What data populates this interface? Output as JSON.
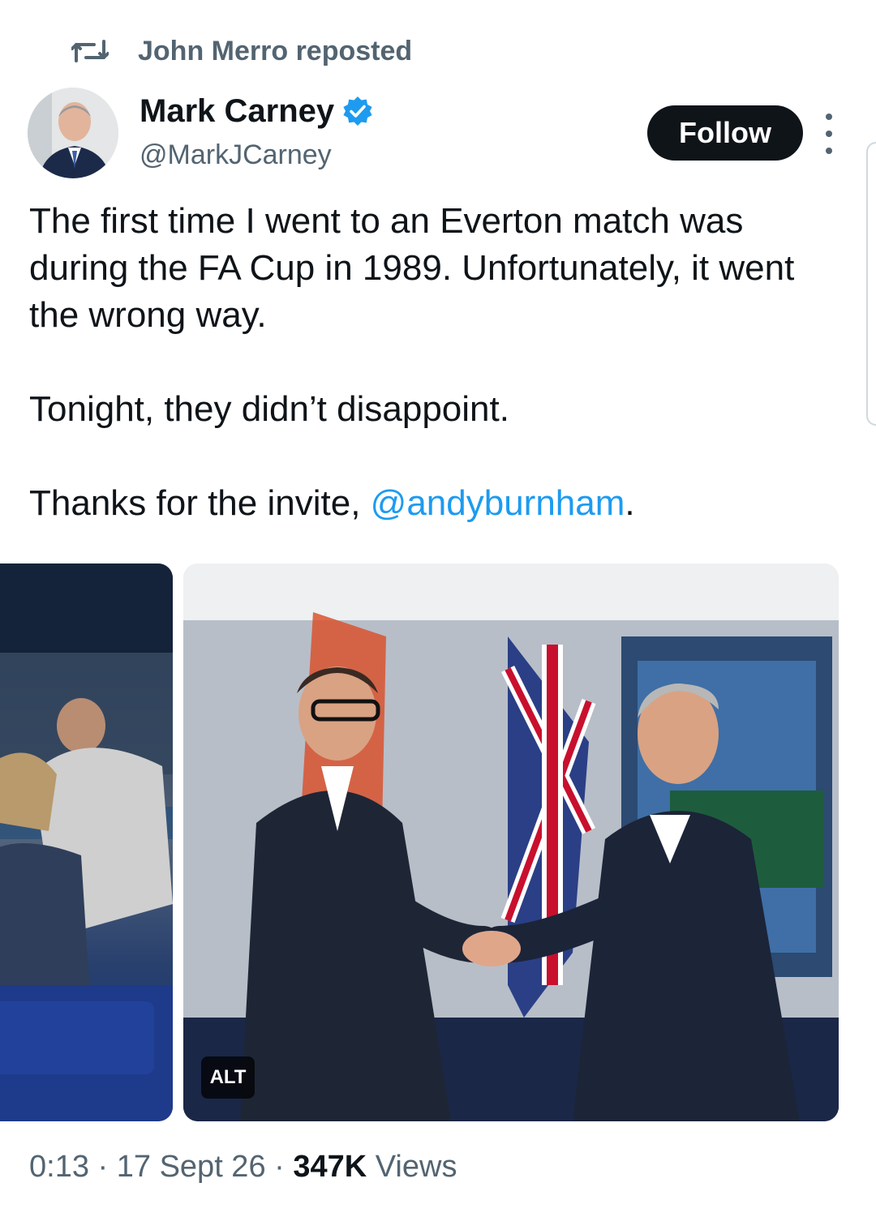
{
  "repost": {
    "label": "John Merro reposted",
    "icon": "repost-icon"
  },
  "author": {
    "name": "Mark Carney",
    "handle": "@MarkJCarney",
    "verified": true
  },
  "follow_label": "Follow",
  "tweet": {
    "paragraph1": "The first time I went to an Everton match was during the FA Cup in 1989. Unfortunately, it went the wrong way.",
    "paragraph2": "Tonight, they didn’t disappoint.",
    "paragraph3_prefix": "Thanks for the invite, ",
    "mention": "@andyburnham",
    "paragraph3_suffix": "."
  },
  "media": {
    "alt_badge": "ALT"
  },
  "meta": {
    "time": "0:13",
    "separator": "·",
    "date": "17 Sept 26",
    "views_count": "347K",
    "views_label": "Views"
  },
  "colors": {
    "accent": "#1d9bf0",
    "text": "#0f1419",
    "secondary": "#536471"
  }
}
